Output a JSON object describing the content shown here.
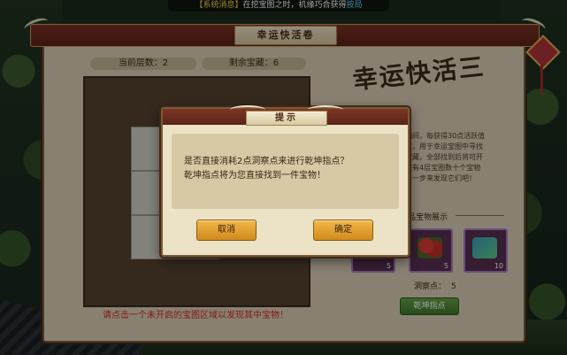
{
  "notice": {
    "prefix": "【系统消息】",
    "text": "在挖宝图之时，机缘巧合获得",
    "suffix": "按局"
  },
  "panel": {
    "title": "幸运快活卷",
    "logo": "幸运快活三",
    "layers_label": "当前层数：2",
    "remain_label": "剩余宝藏：6",
    "hint": "请点击一个未开启的宝图区域以发现其中宝物！",
    "desc": [
      "日期间，每获得30点活跃值",
      "察点，用于幸运宝图中寻找",
      "",
      "表宝藏，全部找到后将可开",
      "一共有4层宝图数十个宝物",
      "一步一步来发现它们吧！"
    ],
    "showcase_title": "极品宝物展示",
    "items": [
      {
        "icon": "treasure-chest-icon",
        "count": "5"
      },
      {
        "icon": "red-fruit-icon",
        "count": "5"
      },
      {
        "icon": "jade-scroll-icon",
        "count": "10"
      }
    ],
    "points_label": "洞察点：",
    "points_value": "5",
    "qiankun_button": "乾坤指点"
  },
  "dialog": {
    "title": "提示",
    "line1": "是否直接消耗2点洞察点来进行乾坤指点？",
    "line2": "乾坤指点将为您直接找到一件宝物！",
    "cancel": "取消",
    "confirm": "确定"
  },
  "colors": {
    "panel_bg": "#dcd1b8",
    "header_red": "#7b3224",
    "hint_red": "#d62b1d",
    "button_gold": "#f3b84a",
    "button_green": "#3e7a2a"
  }
}
